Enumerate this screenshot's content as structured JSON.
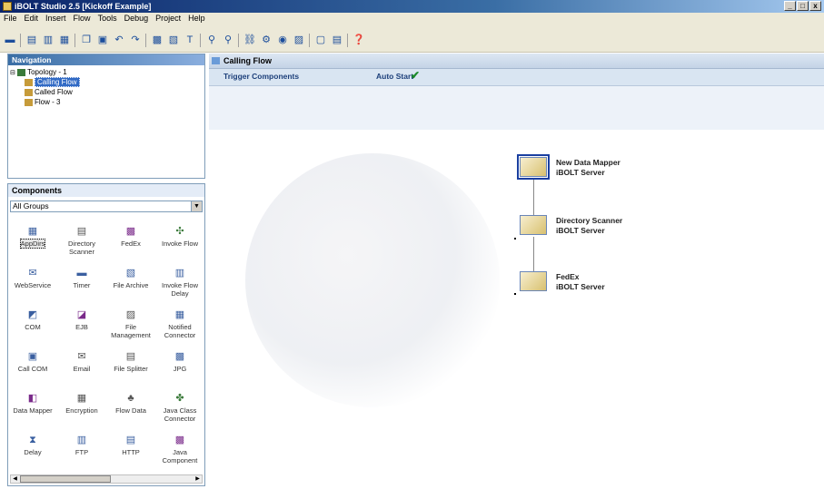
{
  "window": {
    "title": "iBOLT Studio 2.5 [Kickoff  Example]",
    "min": "_",
    "max": "□",
    "close": "x"
  },
  "menu": [
    "File",
    "Edit",
    "Insert",
    "Flow",
    "Tools",
    "Debug",
    "Project",
    "Help"
  ],
  "navigation": {
    "header": "Navigation",
    "tree": [
      {
        "label": "Topology - 1"
      },
      {
        "label": "Calling Flow"
      },
      {
        "label": "Called Flow"
      },
      {
        "label": "Flow - 3"
      }
    ]
  },
  "components": {
    "header": "Components",
    "group": "All Groups",
    "items": [
      [
        "AppDirs",
        "Directory Scanner",
        "FedEx",
        "Invoke Flow"
      ],
      [
        "WebService",
        "Timer",
        "File Archive",
        "Invoke Flow Delay"
      ],
      [
        "COM",
        "EJB",
        "File Management",
        "Notified Connector"
      ],
      [
        "Call COM",
        "Email",
        "File Splitter",
        "JPG"
      ],
      [
        "Data Mapper",
        "Encryption",
        "Flow Data",
        "Java Class Connector"
      ],
      [
        "Delay",
        "FTP",
        "HTTP",
        "Java Component"
      ]
    ]
  },
  "main": {
    "header": "Calling Flow",
    "trigger_label": "Trigger Components",
    "auto_start_label": "Auto Start",
    "nodes": [
      {
        "name": "New Data Mapper",
        "server": "iBOLT Server",
        "icon": "data-mapper-icon"
      },
      {
        "name": "Directory Scanner",
        "server": "iBOLT Server",
        "icon": "directory-scanner-icon"
      },
      {
        "name": "FedEx",
        "server": "iBOLT Server",
        "icon": "fedex-icon"
      }
    ]
  }
}
